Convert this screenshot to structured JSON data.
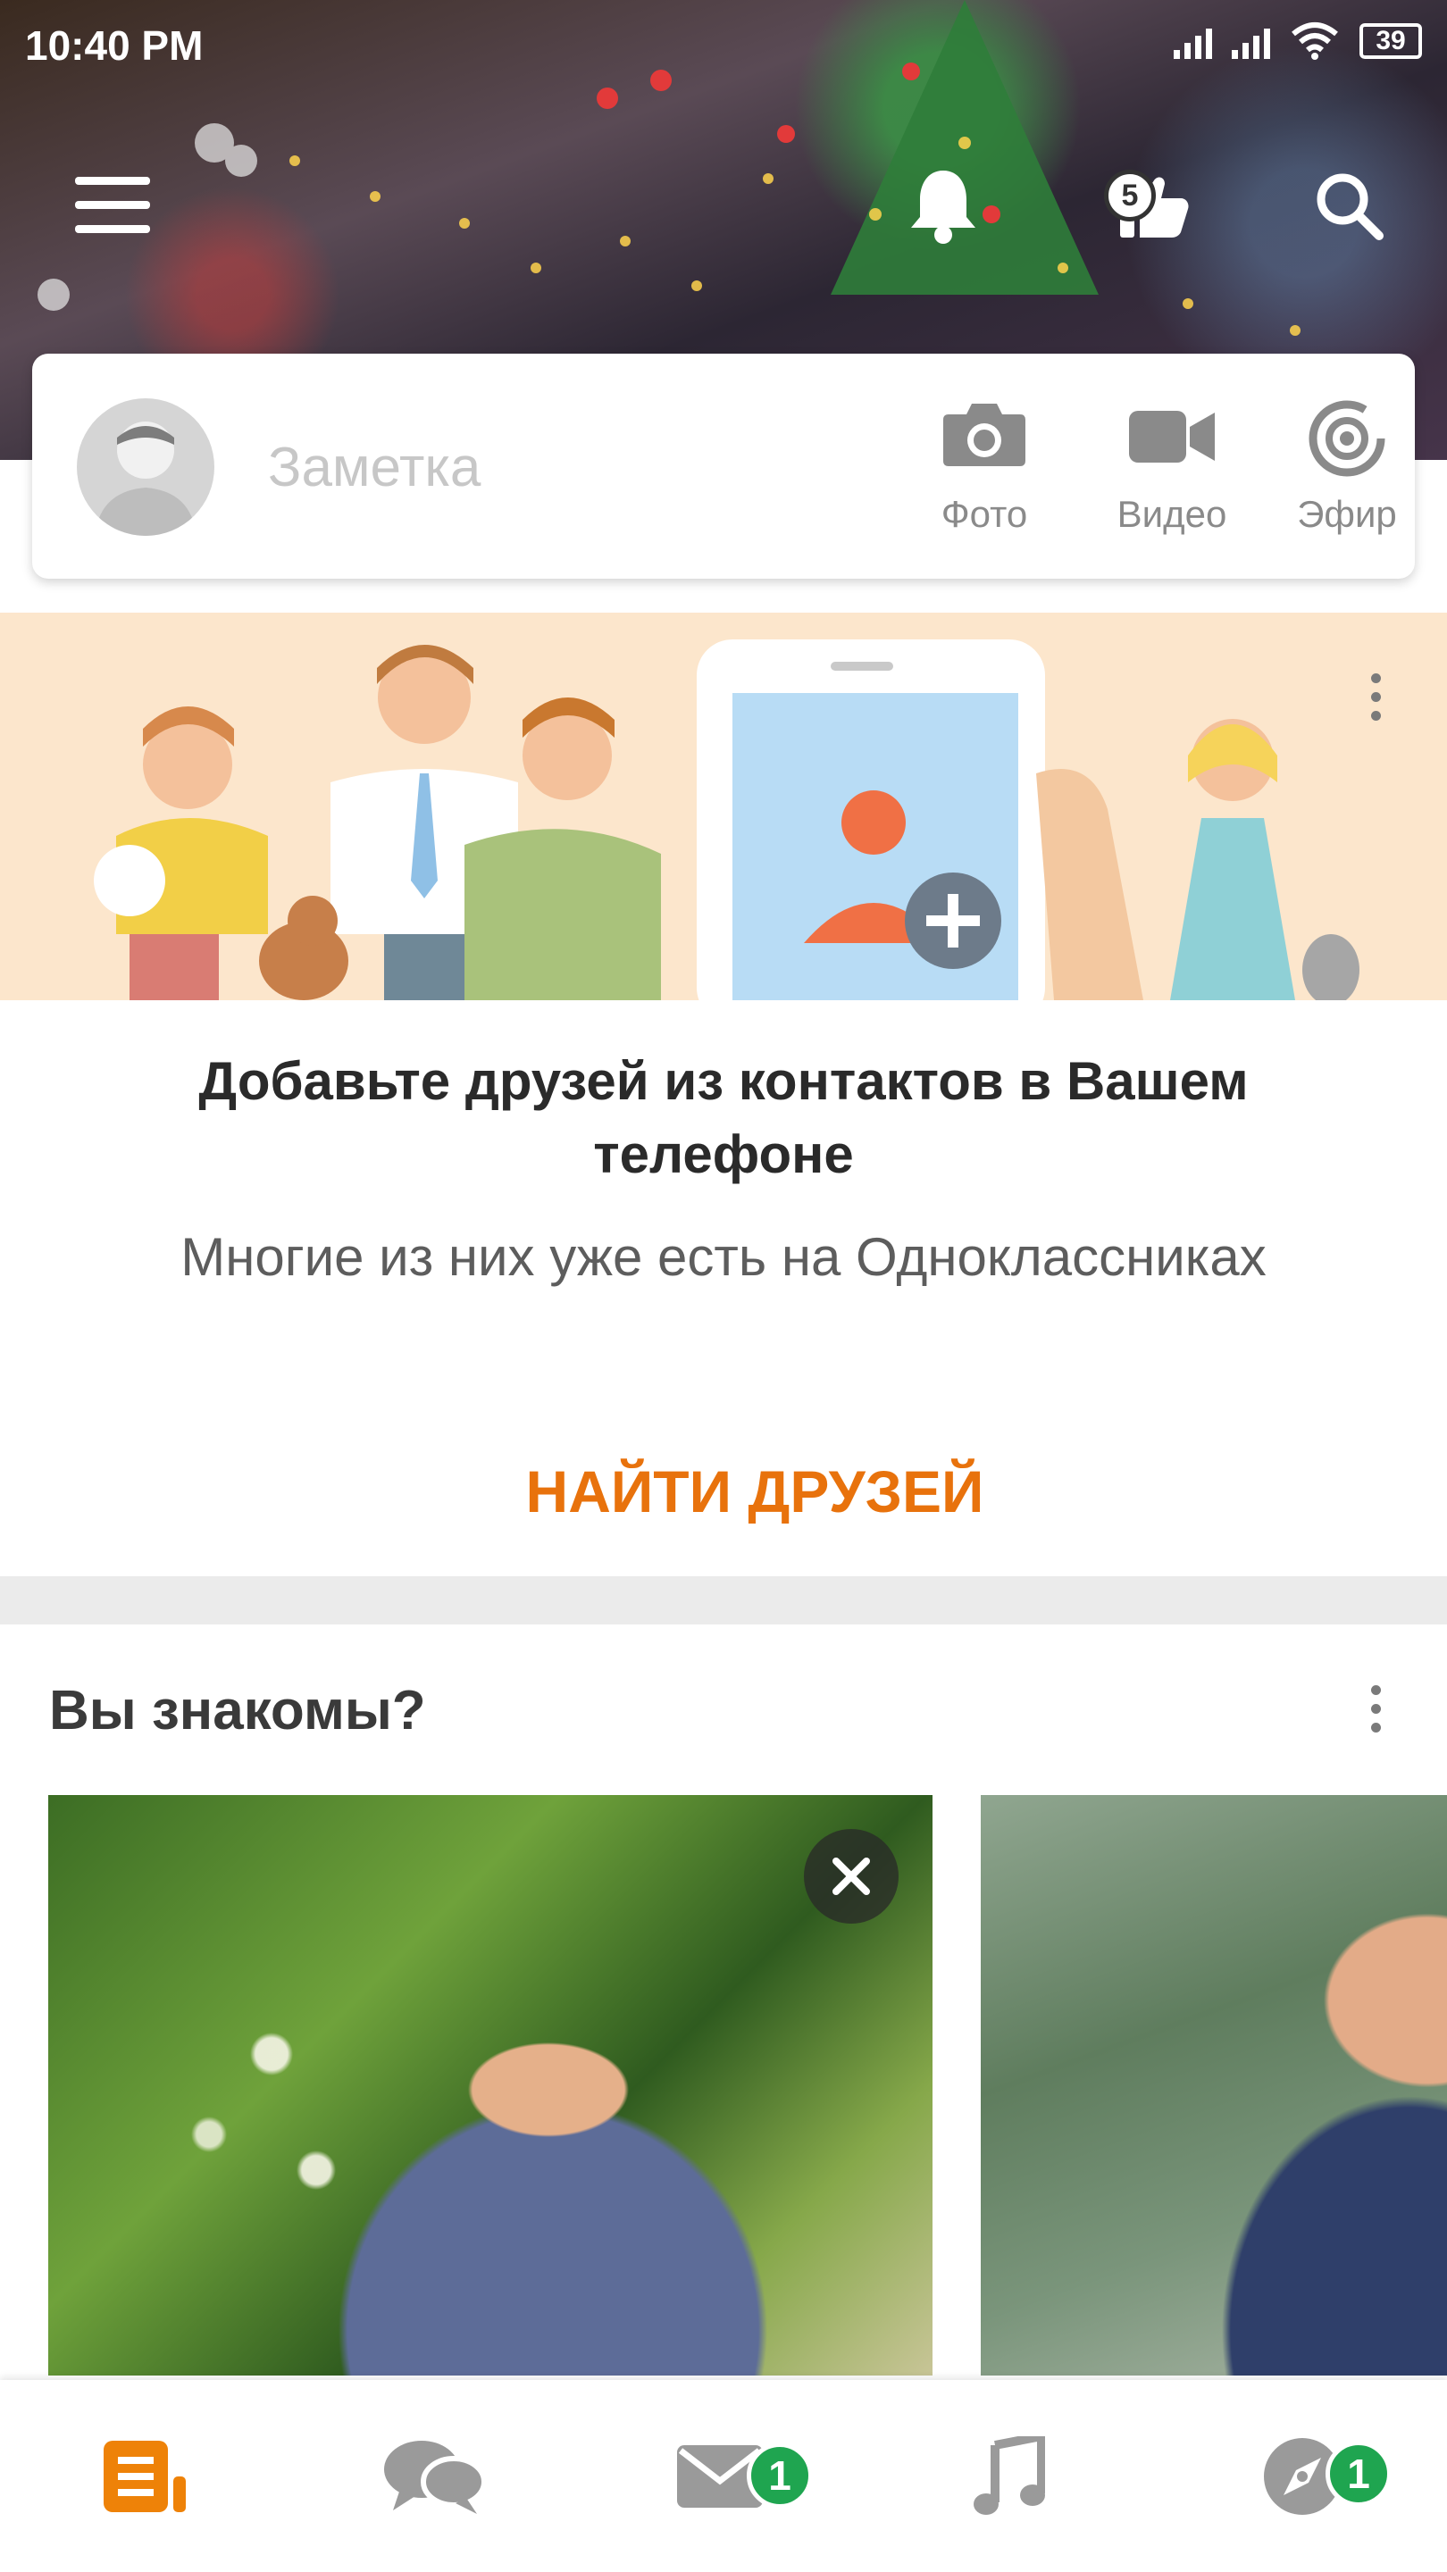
{
  "status_bar": {
    "time": "10:40 PM",
    "battery": "39"
  },
  "top_bar": {
    "menu_icon": "hamburger-icon",
    "notifications_icon": "bell-icon",
    "likes_count": "5",
    "likes_icon": "thumbs-up-icon",
    "search_icon": "search-icon"
  },
  "composer": {
    "placeholder": "Заметка",
    "photo_label": "Фото",
    "video_label": "Видео",
    "live_label": "Эфир"
  },
  "promo": {
    "title": "Добавьте друзей из контактов в Вашем телефоне",
    "subtitle": "Многие из них уже есть на Одноклассниках",
    "button": "НАЙТИ ДРУЗЕЙ"
  },
  "suggestions": {
    "title": "Вы знакомы?"
  },
  "bottom_nav": {
    "items": [
      {
        "icon": "feed-icon",
        "active": true,
        "badge": ""
      },
      {
        "icon": "discussions-icon",
        "active": false,
        "badge": ""
      },
      {
        "icon": "messages-icon",
        "active": false,
        "badge": "1"
      },
      {
        "icon": "music-icon",
        "active": false,
        "badge": ""
      },
      {
        "icon": "explore-icon",
        "active": false,
        "badge": "1"
      }
    ]
  },
  "colors": {
    "accent": "#e8720c",
    "badge_green": "#1fa550",
    "promo_bg": "#fce6cc",
    "icon_gray": "#8a8a8a"
  }
}
